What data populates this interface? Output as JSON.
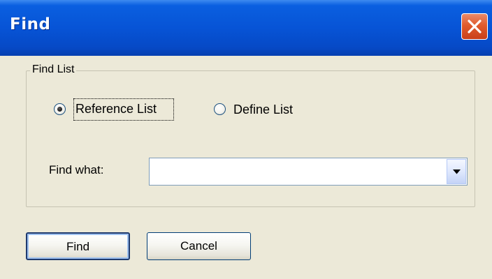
{
  "window": {
    "title": "Find"
  },
  "group": {
    "legend": "Find List"
  },
  "options": {
    "reference_list": {
      "label": "Reference List",
      "selected": true
    },
    "define_list": {
      "label": "Define List",
      "selected": false
    }
  },
  "find_what": {
    "label": "Find what:",
    "value": ""
  },
  "buttons": {
    "find_label": "Find",
    "cancel_label": "Cancel"
  },
  "icons": {
    "close": "close-icon",
    "dropdown": "chevron-down-icon"
  },
  "colors": {
    "titlebar": "#0754d6",
    "close_button": "#e15b2c",
    "dialog_face": "#ece9d8"
  }
}
